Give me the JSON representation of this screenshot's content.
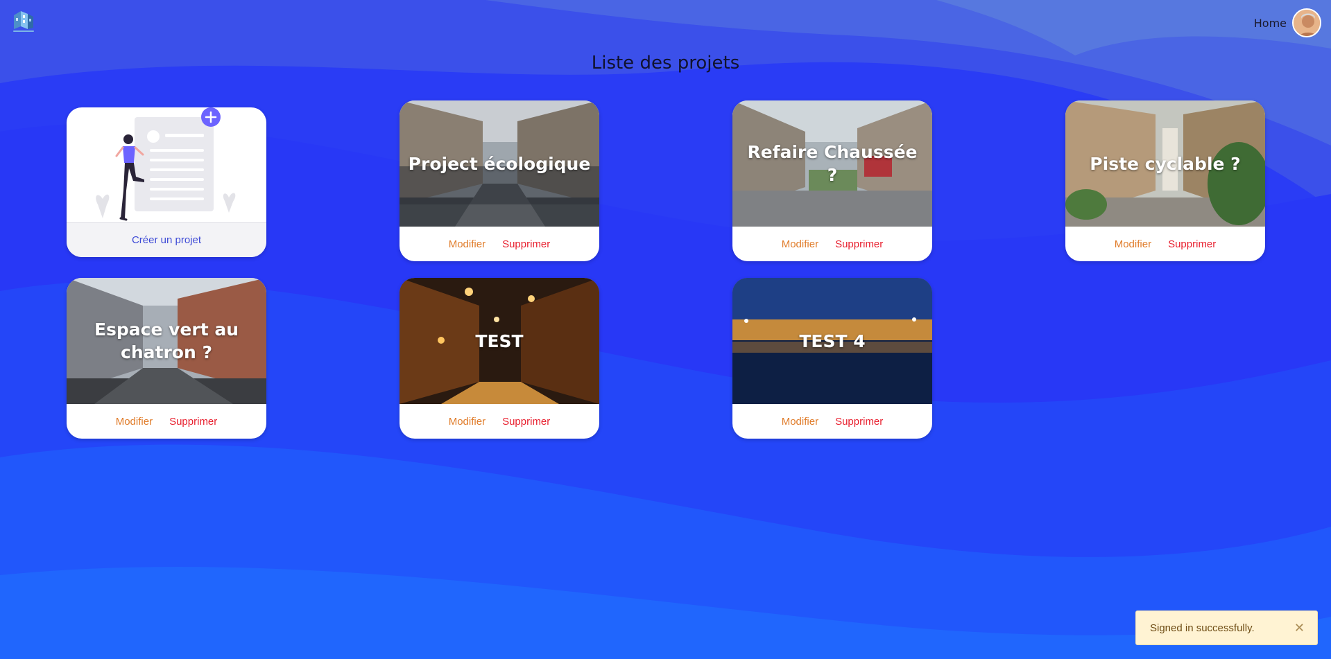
{
  "header": {
    "logo": "building-logo",
    "home_label": "Home",
    "avatar": "user-avatar"
  },
  "page": {
    "title": "Liste des projets"
  },
  "create_card": {
    "label": "Créer un projet",
    "icon": "plus-icon"
  },
  "projects": [
    {
      "title": "Project écologique",
      "modify_label": "Modifier",
      "delete_label": "Supprimer",
      "image": "city-street-photo"
    },
    {
      "title": "Refaire Chaussée ?",
      "modify_label": "Modifier",
      "delete_label": "Supprimer",
      "image": "pedestrian-street-photo"
    },
    {
      "title": "Piste cyclable ?",
      "modify_label": "Modifier",
      "delete_label": "Supprimer",
      "image": "mews-street-photo"
    },
    {
      "title": "Espace vert au chatron ?",
      "modify_label": "Modifier",
      "delete_label": "Supprimer",
      "image": "old-town-street-photo"
    },
    {
      "title": "TEST",
      "modify_label": "Modifier",
      "delete_label": "Supprimer",
      "image": "night-street-photo"
    },
    {
      "title": "TEST 4",
      "modify_label": "Modifier",
      "delete_label": "Supprimer",
      "image": "waterfront-night-photo"
    }
  ],
  "toast": {
    "message": "Signed in successfully.",
    "close_icon": "close-icon"
  },
  "colors": {
    "background": "#2a3cf5",
    "modify": "#e07c2a",
    "delete": "#e8202f",
    "create_label": "#3d4ad6",
    "plus_badge": "#6c63ff",
    "toast_bg": "#fff3d3"
  }
}
